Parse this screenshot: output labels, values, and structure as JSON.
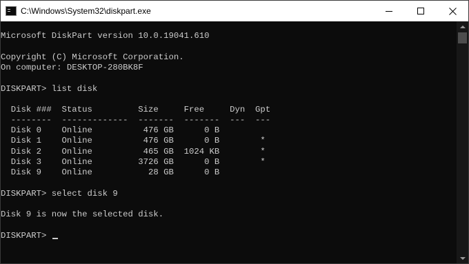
{
  "window": {
    "title": "C:\\Windows\\System32\\diskpart.exe",
    "icon": "cmd-icon",
    "colors": {
      "background": "#0c0c0c",
      "text": "#cccccc",
      "titlebar": "#ffffff"
    }
  },
  "console": {
    "version": "Microsoft DiskPart version 10.0.19041.610",
    "copyright": "Copyright (C) Microsoft Corporation.",
    "computer": "On computer: DESKTOP-280BK8F",
    "command1": "DISKPART> list disk",
    "table": {
      "header": "  Disk ###  Status         Size     Free     Dyn  Gpt",
      "separator": "  --------  -------------  -------  -------  ---  ---",
      "rows": [
        "  Disk 0    Online          476 GB      0 B",
        "  Disk 1    Online          476 GB      0 B        *",
        "  Disk 2    Online          465 GB  1024 KB        *",
        "  Disk 3    Online         3726 GB      0 B        *",
        "  Disk 9    Online           28 GB      0 B"
      ]
    },
    "command2": "DISKPART> select disk 9",
    "message": "Disk 9 is now the selected disk.",
    "prompt": "DISKPART> "
  }
}
